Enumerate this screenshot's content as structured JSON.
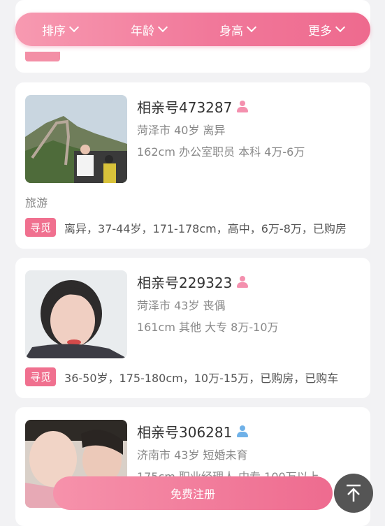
{
  "filters": [
    {
      "label": "排序"
    },
    {
      "label": "年龄"
    },
    {
      "label": "身高"
    },
    {
      "label": "更多"
    }
  ],
  "profiles": [
    {
      "title": "相亲号473287",
      "gender_icon": "female-user-icon",
      "line1": "菏泽市 40岁 离异",
      "line2": "162cm 办公室职员 本科 4万-6万",
      "interest": "旅游",
      "seek_label": "寻觅",
      "seek_text": "离异，37-44岁，171-178cm，高中，6万-8万，已购房"
    },
    {
      "title": "相亲号229323",
      "gender_icon": "female-user-icon",
      "line1": "菏泽市 43岁 丧偶",
      "line2": "161cm 其他 大专 8万-10万",
      "seek_label": "寻觅",
      "seek_text": "36-50岁，175-180cm，10万-15万，已购房，已购车"
    },
    {
      "title": "相亲号306281",
      "gender_icon": "male-user-icon",
      "line1": "济南市 43岁 短婚未育",
      "line2": "175cm 职业经理人 中专 100万以上"
    }
  ],
  "register_button": "免费注册",
  "colors": {
    "accent": "#ee6b8f",
    "accent_light": "#f79ab1",
    "male_icon": "#6fb1e8",
    "female_icon": "#f490ae"
  }
}
